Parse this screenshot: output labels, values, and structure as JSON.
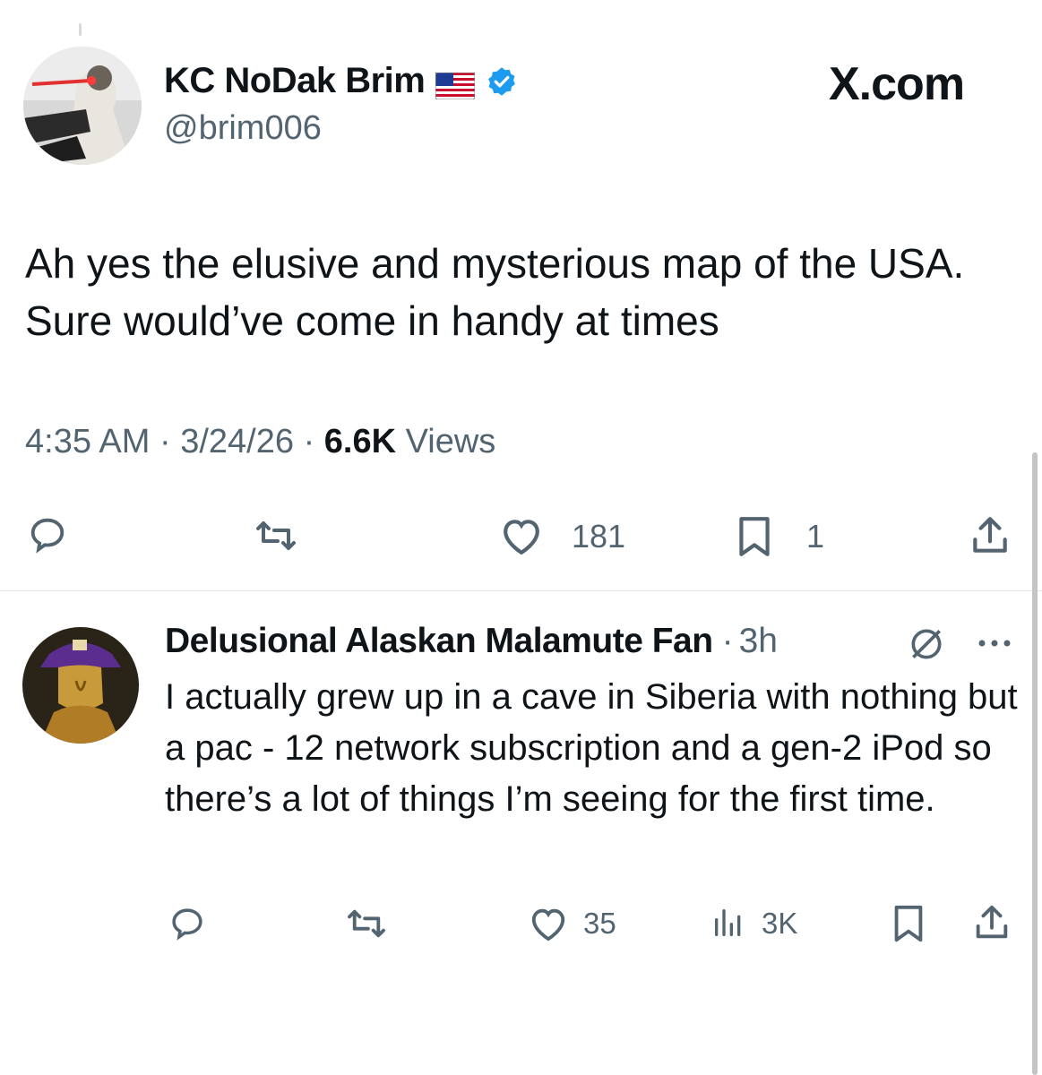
{
  "source_label": "X.com",
  "tweet": {
    "author_name": "KC NoDak Brim",
    "flag_icon": "us-flag-icon",
    "verified_icon": "verified-badge-icon",
    "handle": "@brim006",
    "text": "Ah yes the elusive and mysterious map of the USA. Sure would’ve come in handy at times",
    "time": "4:35 AM",
    "date": "3/24/26",
    "views_count": "6.6K",
    "views_label": "Views",
    "likes": "181",
    "bookmarks": "1"
  },
  "reply": {
    "author_name": "Delusional Alaskan Malamute Fan",
    "age": "3h",
    "text": "I actually grew up in a cave in Siberia with nothing but a pac - 12 network subscription and a gen-2 iPod so there’s a lot of things I’m seeing for the first time.",
    "likes": "35",
    "views": "3K"
  },
  "colors": {
    "text": "#0f1419",
    "secondary": "#536471",
    "verified": "#1d9bf0",
    "divider": "#e6e6e6"
  }
}
